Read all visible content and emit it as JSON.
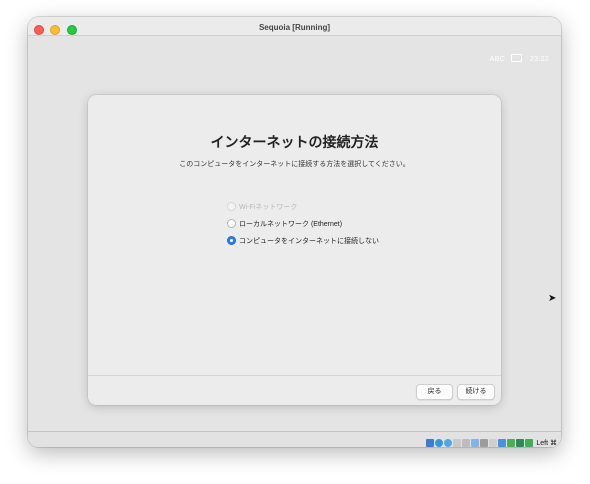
{
  "window": {
    "title": "Sequoia [Running]"
  },
  "guest_status": {
    "input_source": "ABC",
    "time": "23:22"
  },
  "dialog": {
    "title": "インターネットの接続方法",
    "subtitle": "このコンピュータをインターネットに接続する方法を選択してください。",
    "options": [
      {
        "label": "Wi-Fiネットワーク",
        "state": "disabled"
      },
      {
        "label": "ローカルネットワーク (Ethernet)",
        "state": "unselected"
      },
      {
        "label": "コンピュータをインターネットに接続しない",
        "state": "selected"
      }
    ],
    "buttons": {
      "back": "戻る",
      "continue": "続ける"
    }
  },
  "statusbar": {
    "icons": [
      "storage-icon",
      "optical-drive-icon",
      "audio-icon",
      "network-icon",
      "usb-icon",
      "shared-folder-icon",
      "display-icon",
      "video-capture-icon",
      "recording-icon",
      "cpu-icon",
      "mouse-integration-icon",
      "keyboard-icon"
    ],
    "host_key": "Left ⌘"
  },
  "colors": {
    "accent": "#2a7ef5",
    "red": "#fe5f57",
    "yellow": "#febc2e",
    "green": "#28c840"
  }
}
